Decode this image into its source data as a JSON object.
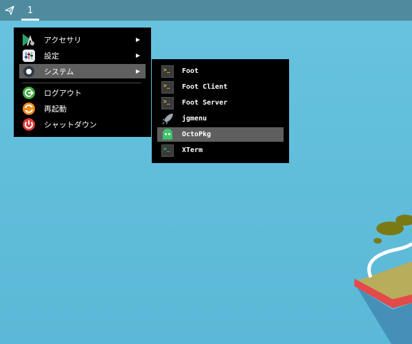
{
  "panel": {
    "launcher_icon": "send-icon",
    "workspace_label": "1"
  },
  "main_menu": {
    "items": [
      {
        "label": "アクセサリ",
        "icon": "accessories-icon",
        "has_submenu": true
      },
      {
        "label": "設定",
        "icon": "settings-icon",
        "has_submenu": true
      },
      {
        "label": "システム",
        "icon": "system-icon",
        "has_submenu": true,
        "selected": true
      },
      {
        "label": "ログアウト",
        "icon": "logout-icon",
        "has_submenu": false
      },
      {
        "label": "再起動",
        "icon": "reboot-icon",
        "has_submenu": false
      },
      {
        "label": "シャットダウン",
        "icon": "power-icon",
        "has_submenu": false
      }
    ],
    "arrow": "▶"
  },
  "system_menu": {
    "items": [
      {
        "label": "Foot",
        "icon": "terminal-icon"
      },
      {
        "label": "Foot Client",
        "icon": "terminal-icon"
      },
      {
        "label": "Foot Server",
        "icon": "terminal-icon"
      },
      {
        "label": "jgmenu",
        "icon": "rocket-icon"
      },
      {
        "label": "OctoPkg",
        "icon": "octopkg-icon",
        "selected": true
      },
      {
        "label": "XTerm",
        "icon": "terminal-icon"
      }
    ]
  },
  "colors": {
    "desktop": "#62bfdc",
    "panel": "#4f8b9f",
    "menu_bg": "#000000",
    "selection": "#5f5f5f"
  }
}
